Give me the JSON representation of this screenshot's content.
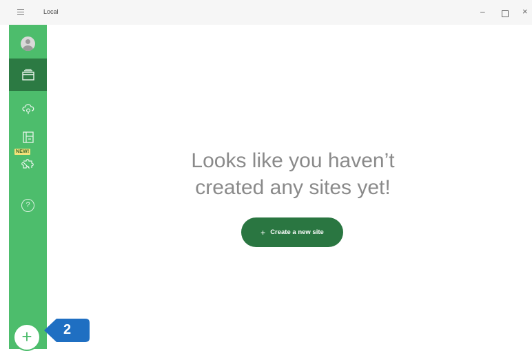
{
  "window": {
    "title": "Local",
    "minimize": "–",
    "close": "×"
  },
  "sidebar": {
    "items": [
      {
        "name": "profile",
        "icon": "avatar-icon"
      },
      {
        "name": "sites",
        "icon": "sites-icon",
        "active": true
      },
      {
        "name": "connect",
        "icon": "cloud-icon"
      },
      {
        "name": "blueprints",
        "icon": "blueprint-icon",
        "badge": "NEW!"
      },
      {
        "name": "addons",
        "icon": "puzzle-icon"
      },
      {
        "name": "help",
        "icon": "help-icon",
        "glyph": "?"
      }
    ],
    "add_button_glyph": "+"
  },
  "main": {
    "empty_line1": "Looks like you haven’t",
    "empty_line2": "created any sites yet!",
    "create_button_label": "Create a new site",
    "create_button_glyph": "+"
  },
  "callout": {
    "number": "2",
    "color": "#1f6fc2"
  },
  "colors": {
    "sidebar": "#4dbd6c",
    "active": "#2c7a43",
    "accent_button": "#2a7641",
    "badge": "#f3e179"
  }
}
